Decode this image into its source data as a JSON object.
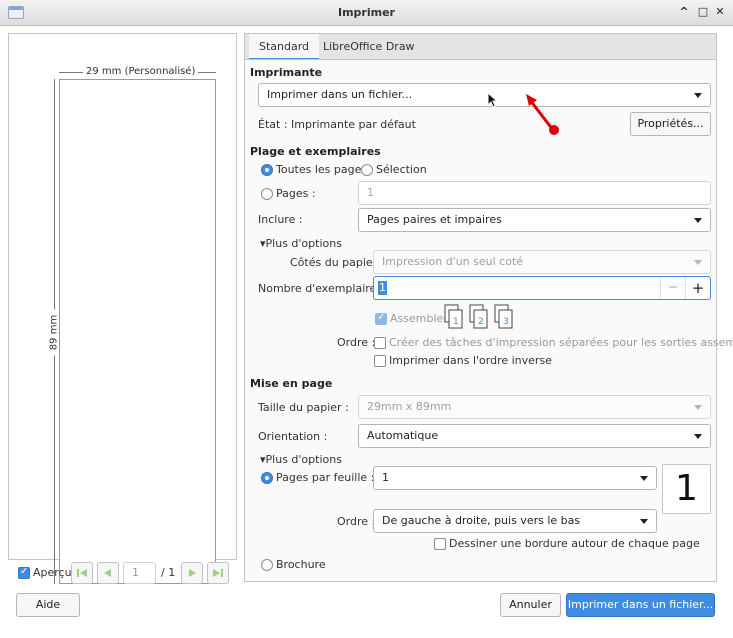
{
  "window": {
    "title": "Imprimer"
  },
  "preview": {
    "width_label": "29 mm (Personnalisé)",
    "height_label": "89 mm",
    "preview_checkbox_label": "Aperçu",
    "page_input": "1",
    "page_total": "/ 1"
  },
  "tabs": [
    "Standard",
    "LibreOffice Draw"
  ],
  "printer": {
    "section": "Imprimante",
    "selected": "Imprimer dans un fichier...",
    "state": "État : Imprimante par défaut",
    "properties_button": "Propriétés..."
  },
  "range": {
    "section": "Plage et exemplaires",
    "all_pages": "Toutes les pages",
    "selection": "Sélection",
    "pages": "Pages :",
    "pages_placeholder": "1",
    "include_label": "Inclure :",
    "include_value": "Pages paires et impaires",
    "more_options": "Plus d'options",
    "paper_sides_label": "Côtés du papier :",
    "paper_sides_value": "Impression d'un seul coté",
    "copies_label": "Nombre d'exemplaires :",
    "copies_value": "1",
    "collate_label": "Assembler",
    "collate_icon_numbers": [
      "1",
      "2",
      "3"
    ],
    "order_label": "Ordre :",
    "separate_jobs": "Créer des tâches d'impression séparées pour les sorties assemblées",
    "reverse_order": "Imprimer dans l'ordre inverse"
  },
  "layout": {
    "section": "Mise en page",
    "paper_size_label": "Taille du papier :",
    "paper_size_value": "29mm x 89mm",
    "orientation_label": "Orientation :",
    "orientation_value": "Automatique",
    "more_options": "Plus d'options",
    "pages_per_sheet_label": "Pages par feuille :",
    "pages_per_sheet_value": "1",
    "pages_per_sheet_preview": "1",
    "order_label": "Ordre :",
    "order_value": "De gauche à droite, puis vers le bas",
    "border_label": "Dessiner une bordure autour de chaque page",
    "brochure_label": "Brochure"
  },
  "buttons": {
    "help": "Aide",
    "cancel": "Annuler",
    "print": "Imprimer dans un fichier..."
  },
  "colors": {
    "accent": "#3f8de0",
    "annotation": "#e00000"
  }
}
